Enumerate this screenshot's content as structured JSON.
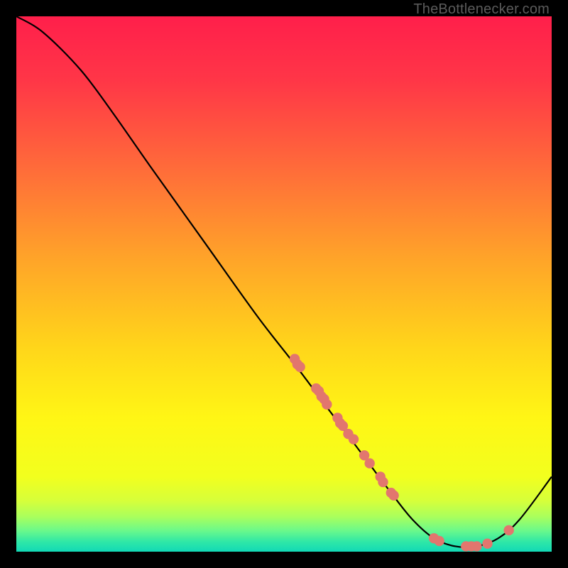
{
  "attribution": "TheBottlenecker.com",
  "chart_data": {
    "type": "line",
    "title": "",
    "xlabel": "",
    "ylabel": "",
    "xlim": [
      0,
      100
    ],
    "ylim": [
      0,
      100
    ],
    "curve": [
      {
        "x": 0.0,
        "y": 100.0
      },
      {
        "x": 5.0,
        "y": 97.0
      },
      {
        "x": 12.0,
        "y": 90.0
      },
      {
        "x": 18.0,
        "y": 82.0
      },
      {
        "x": 25.0,
        "y": 72.0
      },
      {
        "x": 35.0,
        "y": 58.0
      },
      {
        "x": 45.0,
        "y": 44.0
      },
      {
        "x": 52.0,
        "y": 35.0
      },
      {
        "x": 58.0,
        "y": 27.0
      },
      {
        "x": 64.0,
        "y": 19.0
      },
      {
        "x": 70.0,
        "y": 11.0
      },
      {
        "x": 74.0,
        "y": 6.0
      },
      {
        "x": 78.0,
        "y": 2.5
      },
      {
        "x": 82.0,
        "y": 1.0
      },
      {
        "x": 86.0,
        "y": 1.0
      },
      {
        "x": 90.0,
        "y": 2.5
      },
      {
        "x": 94.0,
        "y": 6.0
      },
      {
        "x": 100.0,
        "y": 14.0
      }
    ],
    "markers": [
      {
        "x": 52.0,
        "y": 36.0
      },
      {
        "x": 52.5,
        "y": 35.0
      },
      {
        "x": 53.0,
        "y": 34.5
      },
      {
        "x": 56.0,
        "y": 30.5
      },
      {
        "x": 56.5,
        "y": 30.0
      },
      {
        "x": 57.0,
        "y": 29.0
      },
      {
        "x": 57.5,
        "y": 28.5
      },
      {
        "x": 58.0,
        "y": 27.5
      },
      {
        "x": 60.0,
        "y": 25.0
      },
      {
        "x": 60.5,
        "y": 24.0
      },
      {
        "x": 61.0,
        "y": 23.5
      },
      {
        "x": 62.0,
        "y": 22.0
      },
      {
        "x": 63.0,
        "y": 21.0
      },
      {
        "x": 65.0,
        "y": 18.0
      },
      {
        "x": 66.0,
        "y": 16.5
      },
      {
        "x": 68.0,
        "y": 14.0
      },
      {
        "x": 68.5,
        "y": 13.0
      },
      {
        "x": 70.0,
        "y": 11.0
      },
      {
        "x": 70.5,
        "y": 10.5
      },
      {
        "x": 78.0,
        "y": 2.5
      },
      {
        "x": 79.0,
        "y": 2.0
      },
      {
        "x": 84.0,
        "y": 1.0
      },
      {
        "x": 85.0,
        "y": 1.0
      },
      {
        "x": 86.0,
        "y": 1.0
      },
      {
        "x": 88.0,
        "y": 1.5
      },
      {
        "x": 92.0,
        "y": 4.0
      }
    ],
    "gradient_stops": [
      {
        "pct": 0.0,
        "color": "#ff1f4b"
      },
      {
        "pct": 0.12,
        "color": "#ff3647"
      },
      {
        "pct": 0.28,
        "color": "#ff6a3a"
      },
      {
        "pct": 0.45,
        "color": "#ffa329"
      },
      {
        "pct": 0.62,
        "color": "#ffd61a"
      },
      {
        "pct": 0.75,
        "color": "#fff615"
      },
      {
        "pct": 0.86,
        "color": "#f2ff1e"
      },
      {
        "pct": 0.905,
        "color": "#d6ff3a"
      },
      {
        "pct": 0.935,
        "color": "#a9ff5d"
      },
      {
        "pct": 0.96,
        "color": "#6cf98a"
      },
      {
        "pct": 0.982,
        "color": "#2ee7a7"
      },
      {
        "pct": 1.0,
        "color": "#12d9b6"
      }
    ],
    "marker_color": "#e2766e",
    "curve_color": "#000000"
  }
}
